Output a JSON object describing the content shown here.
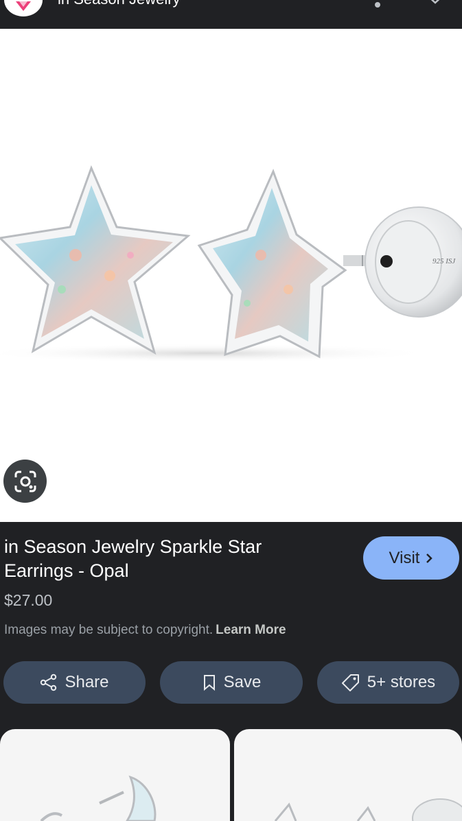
{
  "header": {
    "site_name": "in Season Jewelry",
    "logo_icon": "diamond-logo-icon",
    "more_icon": "more-vert-icon",
    "close_icon": "close-icon"
  },
  "image": {
    "engraving": "925 ISJ",
    "lens_icon": "google-lens-icon"
  },
  "product": {
    "title": "in Season Jewelry Sparkle Star Earrings - Opal",
    "price": "$27.00",
    "copyright_text": "Images may be subject to copyright.",
    "learn_more": "Learn More"
  },
  "actions": {
    "visit": "Visit",
    "share": "Share",
    "save": "Save",
    "stores": "5+ stores"
  },
  "colors": {
    "background": "#202124",
    "visit_button": "#8ab4f8",
    "pill_button": "#3c4a5e"
  }
}
